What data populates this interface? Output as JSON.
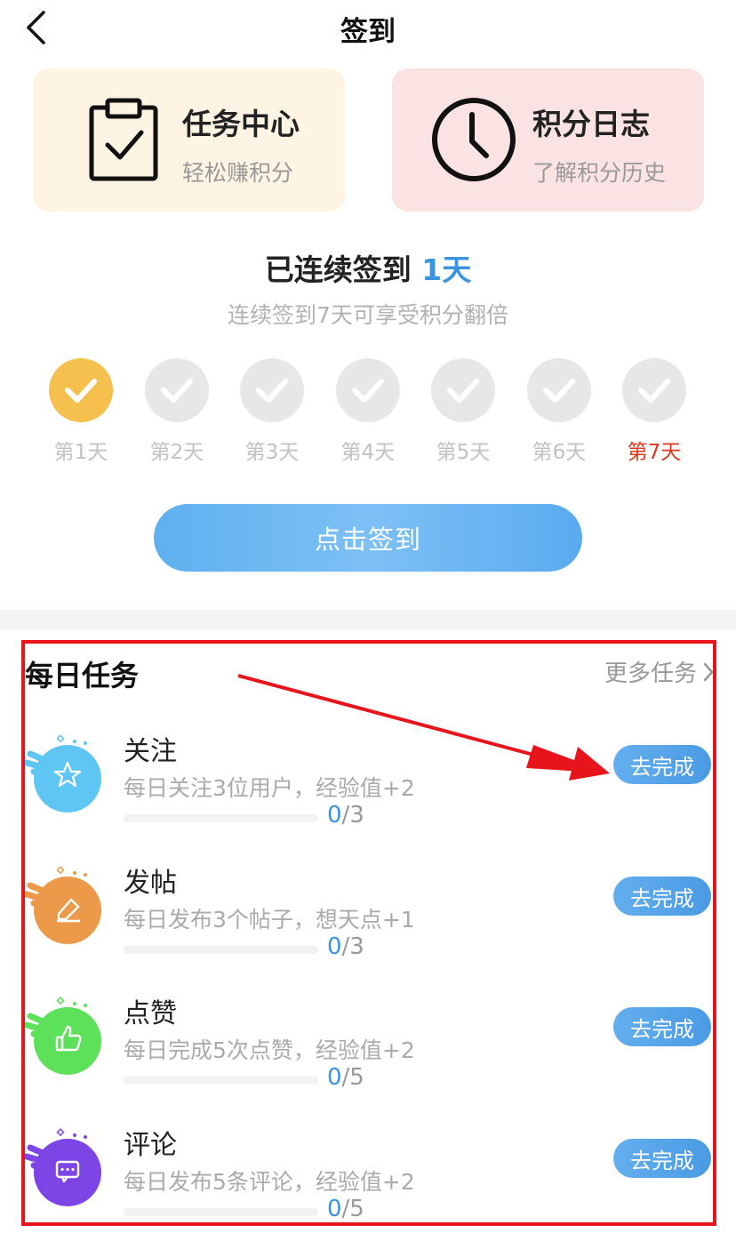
{
  "header": {
    "title": "签到"
  },
  "cards": {
    "task_center": {
      "title": "任务中心",
      "subtitle": "轻松赚积分"
    },
    "points_log": {
      "title": "积分日志",
      "subtitle": "了解积分历史"
    }
  },
  "streak": {
    "prefix": "已连续签到 ",
    "days": "1天",
    "subtitle": "连续签到7天可享受积分翻倍",
    "days_list": [
      {
        "label": "第1天",
        "done": true
      },
      {
        "label": "第2天",
        "done": false
      },
      {
        "label": "第3天",
        "done": false
      },
      {
        "label": "第4天",
        "done": false
      },
      {
        "label": "第5天",
        "done": false
      },
      {
        "label": "第6天",
        "done": false
      },
      {
        "label": "第7天",
        "done": false,
        "bonus": true
      }
    ]
  },
  "signin_button": "点击签到",
  "daily": {
    "title": "每日任务",
    "more": "更多任务",
    "tasks": [
      {
        "name": "关注",
        "desc": "每日关注3位用户，经验值+2",
        "done": "0",
        "total": "/3",
        "button": "去完成",
        "color": "#5fc6f4",
        "icon": "star-icon"
      },
      {
        "name": "发帖",
        "desc": "每日发布3个帖子，想天点+1",
        "done": "0",
        "total": "/3",
        "button": "去完成",
        "color": "#ec9a4a",
        "icon": "edit-icon"
      },
      {
        "name": "点赞",
        "desc": "每日完成5次点赞，经验值+2",
        "done": "0",
        "total": "/5",
        "button": "去完成",
        "color": "#5de05a",
        "icon": "thumb-up-icon"
      },
      {
        "name": "评论",
        "desc": "每日发布5条评论，经验值+2",
        "done": "0",
        "total": "/5",
        "button": "去完成",
        "color": "#7e45e6",
        "icon": "comment-icon"
      }
    ]
  },
  "colors": {
    "accent": "#3a94e0",
    "highlight": "#e8141b",
    "done_day": "#f6c04e",
    "bonus_day": "#d9391e"
  }
}
